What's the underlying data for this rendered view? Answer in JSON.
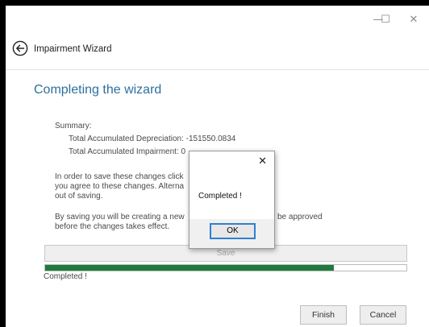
{
  "window": {
    "minimize_glyph": "—",
    "maximize_glyph": "☐",
    "close_glyph": "✕"
  },
  "header": {
    "back_icon": "circle-arrow-left-icon",
    "title": "Impairment Wizard"
  },
  "main": {
    "page_title": "Completing the wizard",
    "summary_label": "Summary:",
    "depreciation_line": "Total Accumulated Depreciation: -151550.0834",
    "impairment_line": "Total Accumulated Impairment: 0",
    "paragraph1": [
      "In order to save these changes click",
      "you agree to these changes. Alterna",
      "out of saving."
    ],
    "paragraph2": [
      "By saving you will be creating a new",
      "before the changes takes effect."
    ],
    "paragraph2_tail": "be approved",
    "save_label": "Save",
    "progress_fraction": 0.8,
    "status": "Completed !"
  },
  "dialog": {
    "close_glyph": "✕",
    "message": "Completed !",
    "ok_label": "OK"
  },
  "footer": {
    "finish_label": "Finish",
    "cancel_label": "Cancel"
  },
  "colors": {
    "accent": "#2e6f9e",
    "progress": "#1f7a3c",
    "focus": "#2f7fd1"
  }
}
